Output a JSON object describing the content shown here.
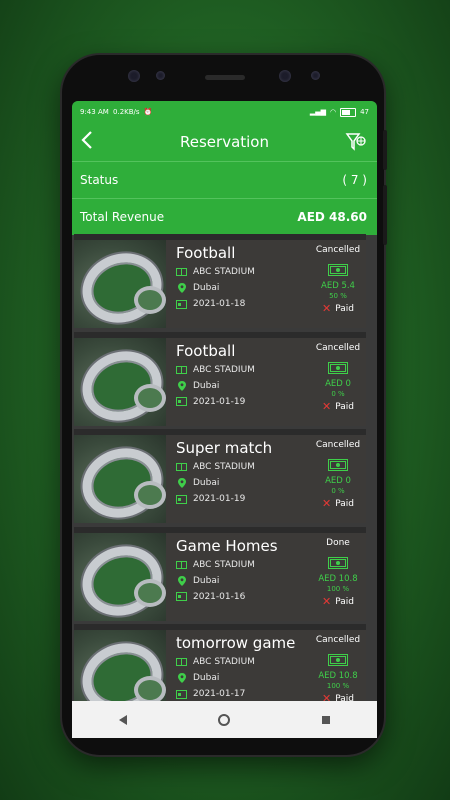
{
  "statusbar": {
    "time": "9:43 AM",
    "speed": "0.2KB/s",
    "battery": "47"
  },
  "header": {
    "title": "Reservation"
  },
  "summary": {
    "status_label": "Status",
    "status_value": "( 7 )",
    "revenue_label": "Total Revenue",
    "revenue_value": "AED 48.60"
  },
  "reservations": [
    {
      "name": "Football",
      "stadium": "ABC STADIUM",
      "city": "Dubai",
      "date": "2021-01-18",
      "status": "Cancelled",
      "amount": "AED 5.4",
      "percent": "50 %",
      "payment": "Paid"
    },
    {
      "name": "Football",
      "stadium": "ABC STADIUM",
      "city": "Dubai",
      "date": "2021-01-19",
      "status": "Cancelled",
      "amount": "AED 0",
      "percent": "0 %",
      "payment": "Paid"
    },
    {
      "name": "Super match",
      "stadium": "ABC STADIUM",
      "city": "Dubai",
      "date": "2021-01-19",
      "status": "Cancelled",
      "amount": "AED 0",
      "percent": "0 %",
      "payment": "Paid"
    },
    {
      "name": "Game Homes",
      "stadium": "ABC STADIUM",
      "city": "Dubai",
      "date": "2021-01-16",
      "status": "Done",
      "amount": "AED 10.8",
      "percent": "100 %",
      "payment": "Paid"
    },
    {
      "name": "tomorrow game",
      "stadium": "ABC STADIUM",
      "city": "Dubai",
      "date": "2021-01-17",
      "status": "Cancelled",
      "amount": "AED 10.8",
      "percent": "100 %",
      "payment": "Paid"
    }
  ],
  "icons": {
    "back": "back-arrow-icon",
    "filter": "filter-icon",
    "stadium": "stadium-icon",
    "location": "location-pin-icon",
    "calendar": "calendar-icon",
    "money": "cash-icon",
    "not_paid": "x-icon"
  },
  "colors": {
    "accent": "#2fae3a",
    "card": "#3c3a38",
    "amount": "#3fcf4a",
    "cross": "#e53935"
  }
}
